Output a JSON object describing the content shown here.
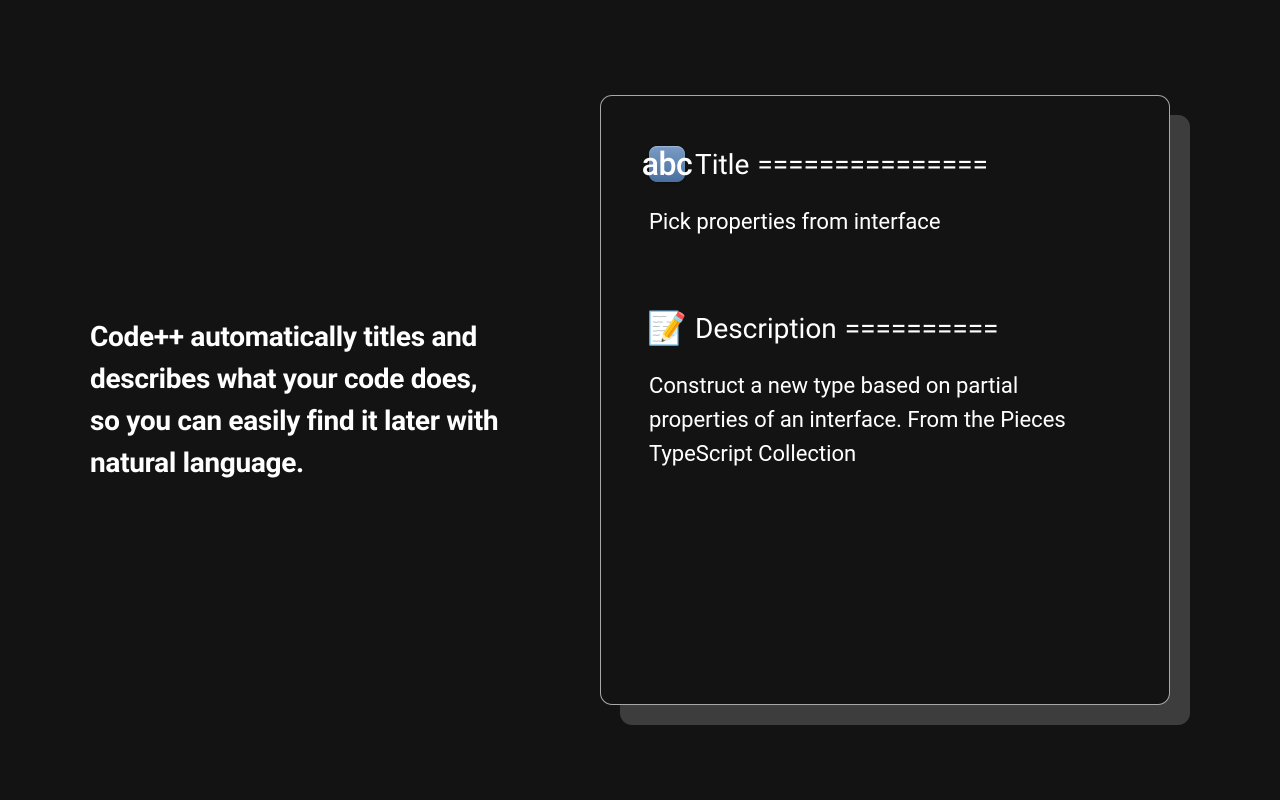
{
  "headline": "Code++ automatically titles and describes what your code does, so you can easily find it later with natural language.",
  "card": {
    "title_section": {
      "icon_name": "abc-icon",
      "icon_text": "abc",
      "label": "Title",
      "separator": "===============",
      "body": "Pick properties from interface"
    },
    "description_section": {
      "icon_name": "memo-icon",
      "icon_glyph": "📝",
      "label": "Description",
      "separator": "==========",
      "body": "Construct a new type based on partial properties of an interface. From the Pieces TypeScript Collection"
    }
  }
}
